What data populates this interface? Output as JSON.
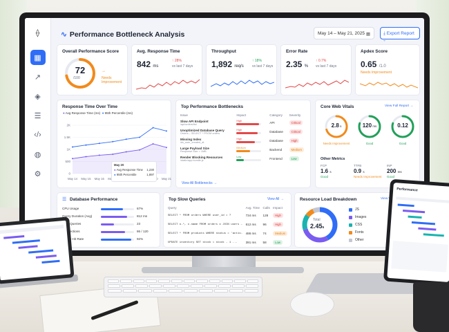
{
  "header": {
    "title": "Performance Bottleneck Analysis",
    "date_range": "May 14 – May 21, 2025",
    "export_label": "Export Report"
  },
  "kpis": {
    "overall": {
      "title": "Overall Performance Score",
      "value": "72",
      "denominator": "/100",
      "score_fraction": 0.72,
      "status": "Needs Improvement"
    },
    "response": {
      "title": "Avg. Response Time",
      "value": "842",
      "unit": "ms",
      "delta": "↑ 28%",
      "compare": "vs last 7 days"
    },
    "throughput": {
      "title": "Throughput",
      "value": "1,892",
      "unit": "req/s",
      "delta": "↑ 18%",
      "compare": "vs last 7 days"
    },
    "error": {
      "title": "Error Rate",
      "value": "2.35",
      "unit": "%",
      "delta": "↑ 0.7%",
      "compare": "vs last 7 days"
    },
    "apdex": {
      "title": "Apdex Score",
      "value": "0.65",
      "denominator": "/1.0",
      "status": "Needs Improvement"
    }
  },
  "response_chart": {
    "title": "Response Time Over Time",
    "legend": [
      "Avg Response Time (ms)",
      "95th Percentile (ms)"
    ],
    "y_ticks": [
      "2K",
      "1.5K",
      "1K",
      "500",
      "0"
    ],
    "x_ticks": [
      "May 14",
      "May 15",
      "May 16",
      "May 17",
      "May 18",
      "May 19",
      "May 20",
      "May 21"
    ],
    "tooltip": {
      "date": "May 20",
      "avg_label": "Avg Response Time",
      "avg_value": "1,230",
      "p95_label": "95th Percentile",
      "p95_value": "1,897"
    }
  },
  "chart_data": {
    "type": "line",
    "x": [
      "May 14",
      "May 15",
      "May 16",
      "May 17",
      "May 18",
      "May 19",
      "May 20",
      "May 21"
    ],
    "ylim": [
      0,
      2000
    ],
    "series": [
      {
        "name": "Avg Response Time (ms)",
        "values": [
          620,
          700,
          760,
          800,
          900,
          980,
          1230,
          1080
        ]
      },
      {
        "name": "95th Percentile (ms)",
        "values": [
          1100,
          1180,
          1250,
          1320,
          1420,
          1500,
          1897,
          1760
        ]
      }
    ]
  },
  "bottlenecks": {
    "title": "Top Performance Bottlenecks",
    "columns": [
      "Issue",
      "Impact",
      "Category",
      "Severity"
    ],
    "rows": [
      {
        "issue": "Slow API Endpoint",
        "sub": "/api/orders/list",
        "impact": "High",
        "impact_level": 0.9,
        "category": "API",
        "severity": "Critical",
        "sev_class": "p-crit"
      },
      {
        "issue": "Unoptimized Database Query",
        "sub": "Orders – SELECT * FROM orders",
        "impact": "High",
        "impact_level": 0.85,
        "category": "Database",
        "severity": "Critical",
        "sev_class": "p-crit"
      },
      {
        "issue": "Missing Index",
        "sub": "idx_user_created_at",
        "impact": "High",
        "impact_level": 0.75,
        "category": "Database",
        "severity": "High",
        "sev_class": "p-high"
      },
      {
        "issue": "Large Payload Size",
        "sub": "Response Size > 1MB",
        "impact": "Medium",
        "impact_level": 0.55,
        "category": "Backend",
        "severity": "Medium",
        "sev_class": "p-med"
      },
      {
        "issue": "Render Blocking Resources",
        "sub": "/static/app.bundle.js",
        "impact": "Low",
        "impact_level": 0.3,
        "category": "Frontend",
        "severity": "Low",
        "sev_class": "p-low"
      }
    ],
    "view_all": "View All Bottlenecks →"
  },
  "web_vitals": {
    "title": "Core Web Vitals",
    "view_full": "View Full Report →",
    "gauges": [
      {
        "value": "2.8",
        "unit": "s",
        "status": "Needs Improvement",
        "color": "#f28a1b",
        "fill": 0.7
      },
      {
        "value": "120",
        "unit": "ms",
        "status": "Good",
        "color": "#22a05a",
        "fill": 0.8
      },
      {
        "value": "0.12",
        "unit": "",
        "status": "Good",
        "color": "#22a05a",
        "fill": 0.8
      }
    ],
    "other_title": "Other Metrics",
    "other": [
      {
        "label": "FCP",
        "value": "1.6",
        "unit": "s",
        "status": "Good"
      },
      {
        "label": "TTFB",
        "value": "0.9",
        "unit": "s",
        "status": "Needs Improvement"
      },
      {
        "label": "INP",
        "value": "200",
        "unit": "ms",
        "status": "Good"
      }
    ]
  },
  "db": {
    "title": "Database Performance",
    "rows": [
      {
        "label": "CPU Usage",
        "value": "67%",
        "level": 0.67,
        "color": "#2f6df6"
      },
      {
        "label": "Query Duration (Avg)",
        "value": "812 ms",
        "level": 0.8,
        "color": "#7a5cf0"
      },
      {
        "label": "Slow Queries",
        "value": "23",
        "level": 0.4,
        "color": "#7a5cf0"
      },
      {
        "label": "Connections",
        "value": "86 / 120",
        "level": 0.72,
        "color": "#7a5cf0"
      },
      {
        "label": "Cache Hit Rate",
        "value": "92%",
        "level": 0.92,
        "color": "#2f6df6"
      }
    ]
  },
  "slow_queries": {
    "title": "Top Slow Queries",
    "view_all": "View All →",
    "columns": [
      "Query",
      "Avg. Time",
      "Calls",
      "Impact"
    ],
    "rows": [
      {
        "query": "SELECT * FROM orders WHERE user_id = ?",
        "time": "734 ms",
        "calls": "128",
        "impact": "High",
        "cls": "p-high"
      },
      {
        "query": "SELECT o.*, c.name FROM orders o JOIN users c...",
        "time": "612 ms",
        "calls": "96",
        "impact": "High",
        "cls": "p-high"
      },
      {
        "query": "SELECT * FROM products WHERE status = 'active'",
        "time": "486 ms",
        "calls": "74",
        "impact": "Medium",
        "cls": "p-med"
      },
      {
        "query": "UPDATE inventory SET stock = stock - 1 ...",
        "time": "391 ms",
        "calls": "58",
        "impact": "Low",
        "cls": "p-low"
      }
    ]
  },
  "resource": {
    "title": "Resource Load Breakdown",
    "view": "View Waterfall →",
    "total_label": "Total",
    "total_value": "2.45",
    "total_unit": "s",
    "items": [
      {
        "name": "JS",
        "pct": "42%",
        "value": 42,
        "color": "#2f6df6"
      },
      {
        "name": "Images",
        "pct": "28%",
        "value": 28,
        "color": "#7a5cf0"
      },
      {
        "name": "CSS",
        "pct": "15%",
        "value": 15,
        "color": "#19b3b0"
      },
      {
        "name": "Fonts",
        "pct": "8%",
        "value": 8,
        "color": "#f28a1b"
      },
      {
        "name": "Other",
        "pct": "7%",
        "value": 7,
        "color": "#c3c7d1"
      }
    ]
  },
  "tablet": {
    "title": "Performance"
  }
}
